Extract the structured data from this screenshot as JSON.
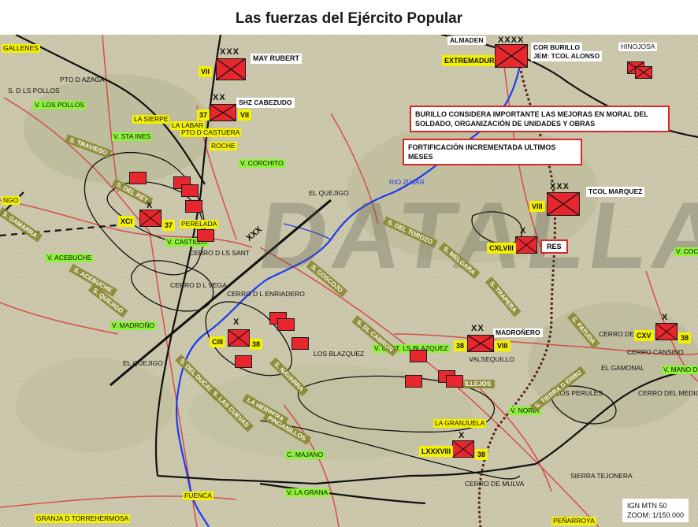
{
  "title": "Las fuerzas del Ejército Popular",
  "watermark": "DATALLAS",
  "colors": {
    "unit_fill": "#e8262e",
    "road_red": "#d83a3a",
    "river": "#1c3cf0",
    "front_black": "#111111",
    "note_border": "#d62a2a",
    "label_yellow": "#f3f000",
    "label_green": "#8cf23a",
    "rail": "#5a2020"
  },
  "place_labels": {
    "gallenes": "GALLENES",
    "pto_azaga": "PTO D AZAGA",
    "s_pollos": "S. D LS POLLOS",
    "v_pollos": "V. LOS POLLOS",
    "la_sierpe": "LA SIERPE",
    "la_labar": "LA LABAR",
    "pto_castuera": "PTO D CASTUERA",
    "v_sta_ines": "V. STA INES",
    "roche": "ROCHE",
    "v_corchito": "V. CORCHITO",
    "rio_zujar": "RIO ZÚJAR",
    "el_quejigo_n": "EL QUEJIGO",
    "perelada": "PERELADA",
    "v_castillo": "V. CASTILLO",
    "cerro_sant": "CERRO D LS SANT",
    "v_acebuche": "V. ACEBUCHE",
    "cerro_vega": "CERRO D L VEGA",
    "cerro_enriadero": "CERRO D L ENRIADERO",
    "v_madrono": "V. MADROÑO",
    "el_quejigo_s": "EL QUEJIGO",
    "los_blazquez": "LOS BLAZQUEZ",
    "v_cast_blazquez": "V. CAST. LS BLAZQUEZ",
    "valsequillo": "VALSEQUILLO",
    "el_gamonal": "EL GAMONAL",
    "cerro_cansino": "CERRO CANSINO",
    "cerro_medico": "CERRO DEL MEDICO",
    "los_perules": "LOS PERULES",
    "v_noria": "V. NORIA",
    "la_granjuela": "LA GRANJUELA",
    "c_majano": "C. MAJANO",
    "v_la_grana": "V. LA GRANA",
    "fuenca": "FUENCA",
    "granja": "GRANJA D TORREHERMOSA",
    "penarroya": "PEÑARROYA",
    "v_mano_de": "V. MANO DE",
    "v_coche": "V. COCHE",
    "cerro_de": "CERRO DE",
    "sierra_tejonera": "SIERRA TEJONERA",
    "cerro_mulva": "CERRO DE MULVA",
    "ngo": "NGO"
  },
  "ridge_labels": {
    "s_travieso": "S. TRAVIESO",
    "s_rey": "S. DEL REY",
    "el_torozo": "S. DEL TOROZO",
    "s_gamarra": "S. GAMARRA",
    "s_acebuche": "S. ACEBUCHE",
    "s_quejigo": "S. QUEJIGO",
    "s_coscojo": "S. COSCOJO",
    "s_melgar": "S. MELGARA",
    "s_trapera": "S. TRAPERA",
    "s_cabron": "S. DL CABRON",
    "s_ducado": "S. DEL DUCADO",
    "s_cuevas": "S. LAS CUEVAS",
    "s_navarra": "S. NAVARRA",
    "herrera": "LA HERRERA",
    "pinganillos": "PINGANILLOS",
    "s_patuda": "S. PATUDA",
    "s_tierra_alta": "S. TIERRA D ERBU",
    "tillejos": "TILLEJOS"
  },
  "locality_tags": {
    "almaden": "ALMADEN",
    "extremadura": "EXTREMADURA",
    "hinojosa": "HINOJOSA",
    "madronero": "MADROÑERO"
  },
  "units": {
    "vii_army": {
      "number": "VII",
      "commander": "MAY RUBERT",
      "echelon": "XXX"
    },
    "vii_37": {
      "number": "VII",
      "division": "37",
      "commander": "SHZ CABEZUDO",
      "echelon": "XX"
    },
    "xci": {
      "number": "XCI",
      "division": "37",
      "echelon": "X"
    },
    "ciii": {
      "number": "CIII",
      "division": "38",
      "echelon": "X"
    },
    "viii_army": {
      "number": "VIII",
      "commander": "TCOL MARQUEZ",
      "echelon": "XXX"
    },
    "cxlviii": {
      "number": "CXLVIII",
      "echelon": "X",
      "reserve": "RES"
    },
    "viii_38": {
      "number": "VIII",
      "division": "38",
      "echelon": "XX"
    },
    "cxv": {
      "number": "CXV",
      "division": "38",
      "echelon": "X"
    },
    "lxxxviii": {
      "number": "LXXXVIII",
      "division": "38",
      "echelon": "X"
    },
    "extremadura_hq": {
      "commander": "COR BURILLO",
      "chief": "JEM: TCOL ALONSO",
      "echelon": "XXXX"
    }
  },
  "boundary_label": "XXX",
  "notes": {
    "burillo": "BURILLO CONSIDERA IMPORTANTE LAS MEJORAS EN MORAL DEL SOLDADO, ORGANIZACIÓN DE UNIDADES Y OBRAS",
    "fortificacion": "FORTIFICACIÓN INCREMENTADA ULTIMOS MESES"
  },
  "scale": {
    "source": "IGN MTN 50",
    "zoom": "ZOOM: 1/150.000"
  }
}
